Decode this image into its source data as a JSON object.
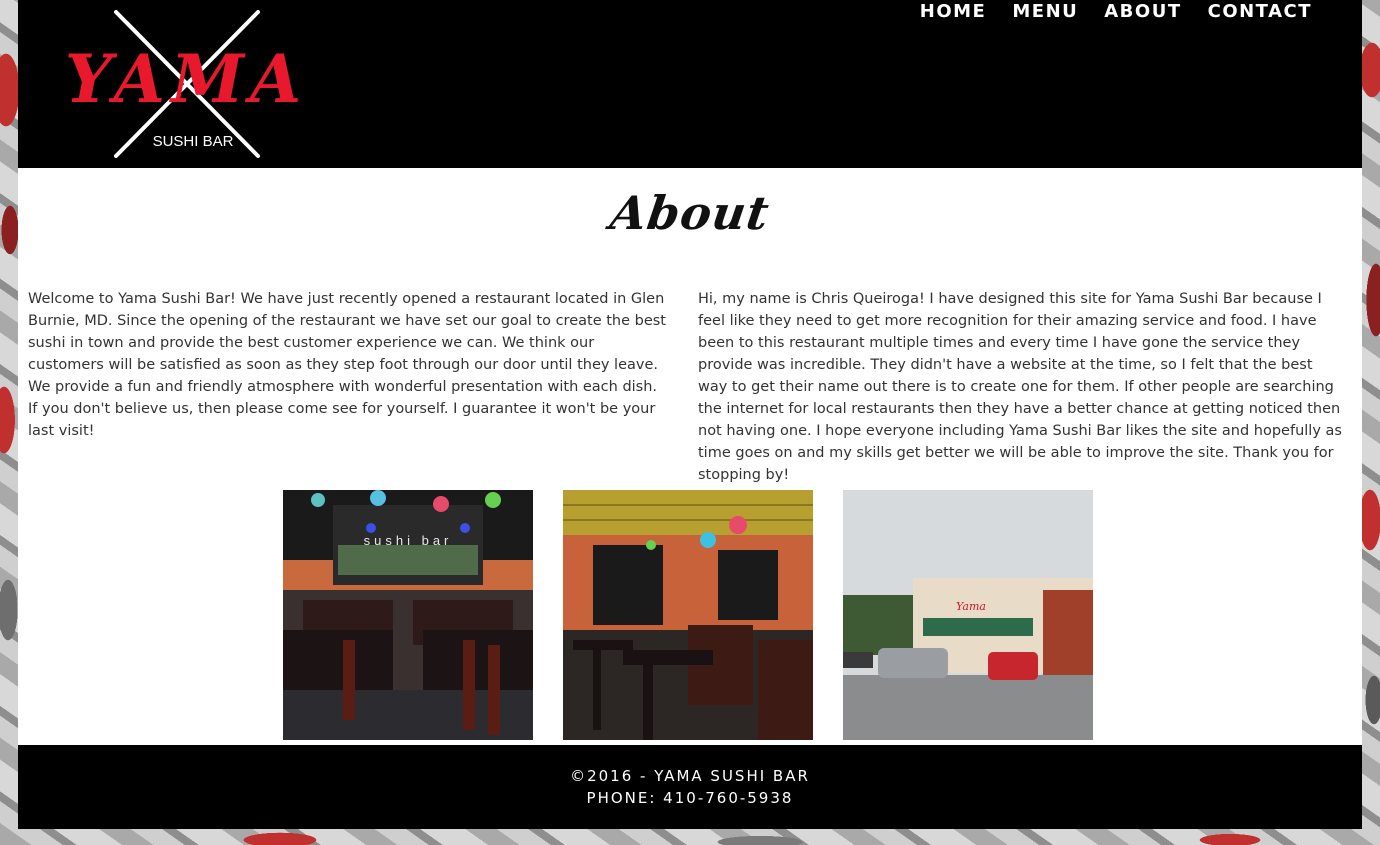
{
  "logo": {
    "name": "YAMA",
    "subtitle": "SUSHI BAR"
  },
  "nav": {
    "items": [
      "HOME",
      "MENU",
      "ABOUT",
      "CONTACT"
    ]
  },
  "about": {
    "title": "About",
    "left_text": "Welcome to Yama Sushi Bar! We have just recently opened a restaurant located in Glen Burnie, MD. Since the opening of the restaurant we have set our goal to create the best sushi in town and provide the best customer experience we can. We think our customers will be satisfied as soon as they step foot through our door until they leave. We provide a fun and friendly atmosphere with wonderful presentation with each dish. If you don't believe us, then please come see for yourself. I guarantee it won't be your last visit!",
    "right_text": "Hi, my name is Chris Queiroga! I have designed this site for Yama Sushi Bar because I feel like they need to get more recognition for their amazing service and food. I have been to this restaurant multiple times and every time I have gone the service they provide was incredible. They didn't have a website at the time, so I felt that the best way to get their name out there is to create one for them. If other people are searching the internet for local restaurants then they have a better chance at getting noticed then not having one. I hope everyone including Yama Sushi Bar likes the site and hopefully as time goes on and my skills get better we will be able to improve the site. Thank you for stopping by!"
  },
  "photos": {
    "sign_text": "sushi bar",
    "storefront_sign": "Yama"
  },
  "footer": {
    "copyright": "©2016 - YAMA SUSHI BAR",
    "phone": "PHONE: 410-760-5938"
  },
  "colors": {
    "brand_red": "#e8192c",
    "header_bg": "#000000",
    "text": "#333333"
  }
}
